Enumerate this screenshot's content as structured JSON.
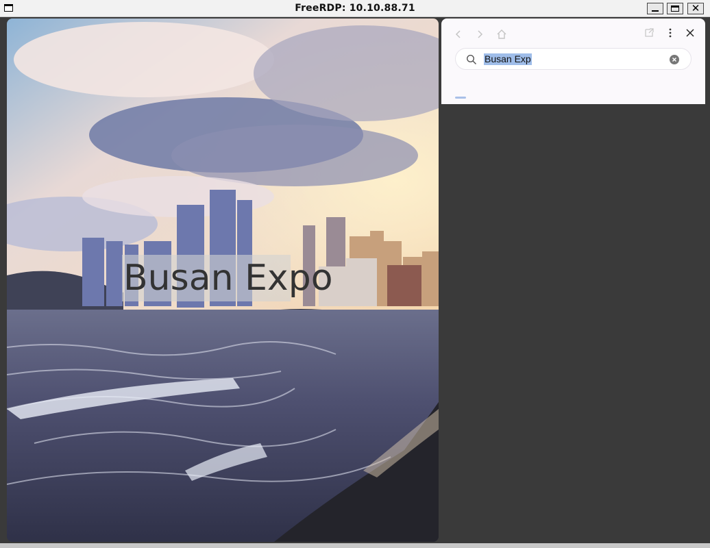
{
  "window": {
    "title": "FreeRDP: 10.10.88.71",
    "icon": "window-icon",
    "controls": [
      "minimize",
      "maximize",
      "close"
    ],
    "close_glyph": "✕"
  },
  "wallpaper": {
    "overlay_text": "Busan Expo"
  },
  "search_panel": {
    "nav": {
      "back_icon": "chevron-left-icon",
      "forward_icon": "chevron-right-icon",
      "home_icon": "home-icon",
      "open_icon": "open-external-icon",
      "more_icon": "more-vertical-icon",
      "close_icon": "close-icon"
    },
    "search": {
      "value": "Busan Exp",
      "selected": true
    }
  },
  "colors": {
    "titlebar": "#f2f2f2",
    "desktop": "#3a3a3a",
    "panel": "#fbf9fc",
    "selection": "#9fbde9",
    "tab_indicator": "#a9c0e8"
  }
}
